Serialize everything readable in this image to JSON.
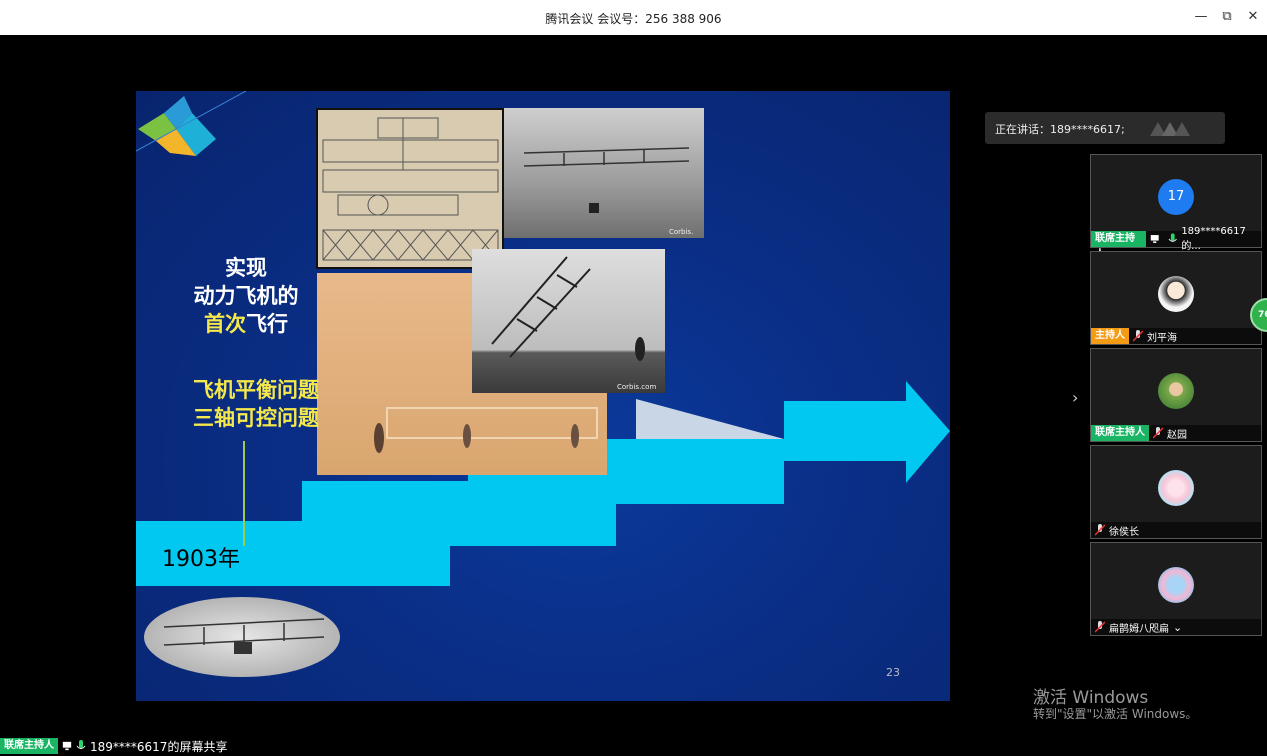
{
  "window": {
    "title": "腾讯会议 会议号：256 388 906",
    "minimize_icon": "—",
    "restore_icon": "⧉",
    "close_icon": "✕"
  },
  "slide": {
    "headline_line1": "实现",
    "headline_line2": "动力飞机的",
    "headline_hl": "首次",
    "headline_rest": "飞行",
    "problem1": "飞机平衡问题",
    "problem2": "三轴可控问题",
    "year": "1903年",
    "page_number": "23",
    "corbis1": "Corbis.",
    "corbis2": "Corbis.com"
  },
  "speaking": {
    "label": "正在讲话：189****6617;"
  },
  "participants": [
    {
      "avatar_text": "17",
      "badge": "联席主持人",
      "badge_color": "green",
      "name": "189****6617的..."
    },
    {
      "avatar_text": "",
      "badge": "主持人",
      "badge_color": "orange",
      "name": "刘平海"
    },
    {
      "avatar_text": "",
      "badge": "联席主持人",
      "badge_color": "green",
      "name": "赵园"
    },
    {
      "avatar_text": "",
      "badge": "",
      "badge_color": "",
      "name": "徐侯长"
    },
    {
      "avatar_text": "",
      "badge": "",
      "badge_color": "",
      "name": "扁鹊姆八咫扁"
    }
  ],
  "side_badge": "76",
  "windows_activation": {
    "line1": "激活 Windows",
    "line2": "转到\"设置\"以激活 Windows。"
  },
  "share": {
    "badge": "联席主持人",
    "text": "189****6617的屏幕共享"
  }
}
